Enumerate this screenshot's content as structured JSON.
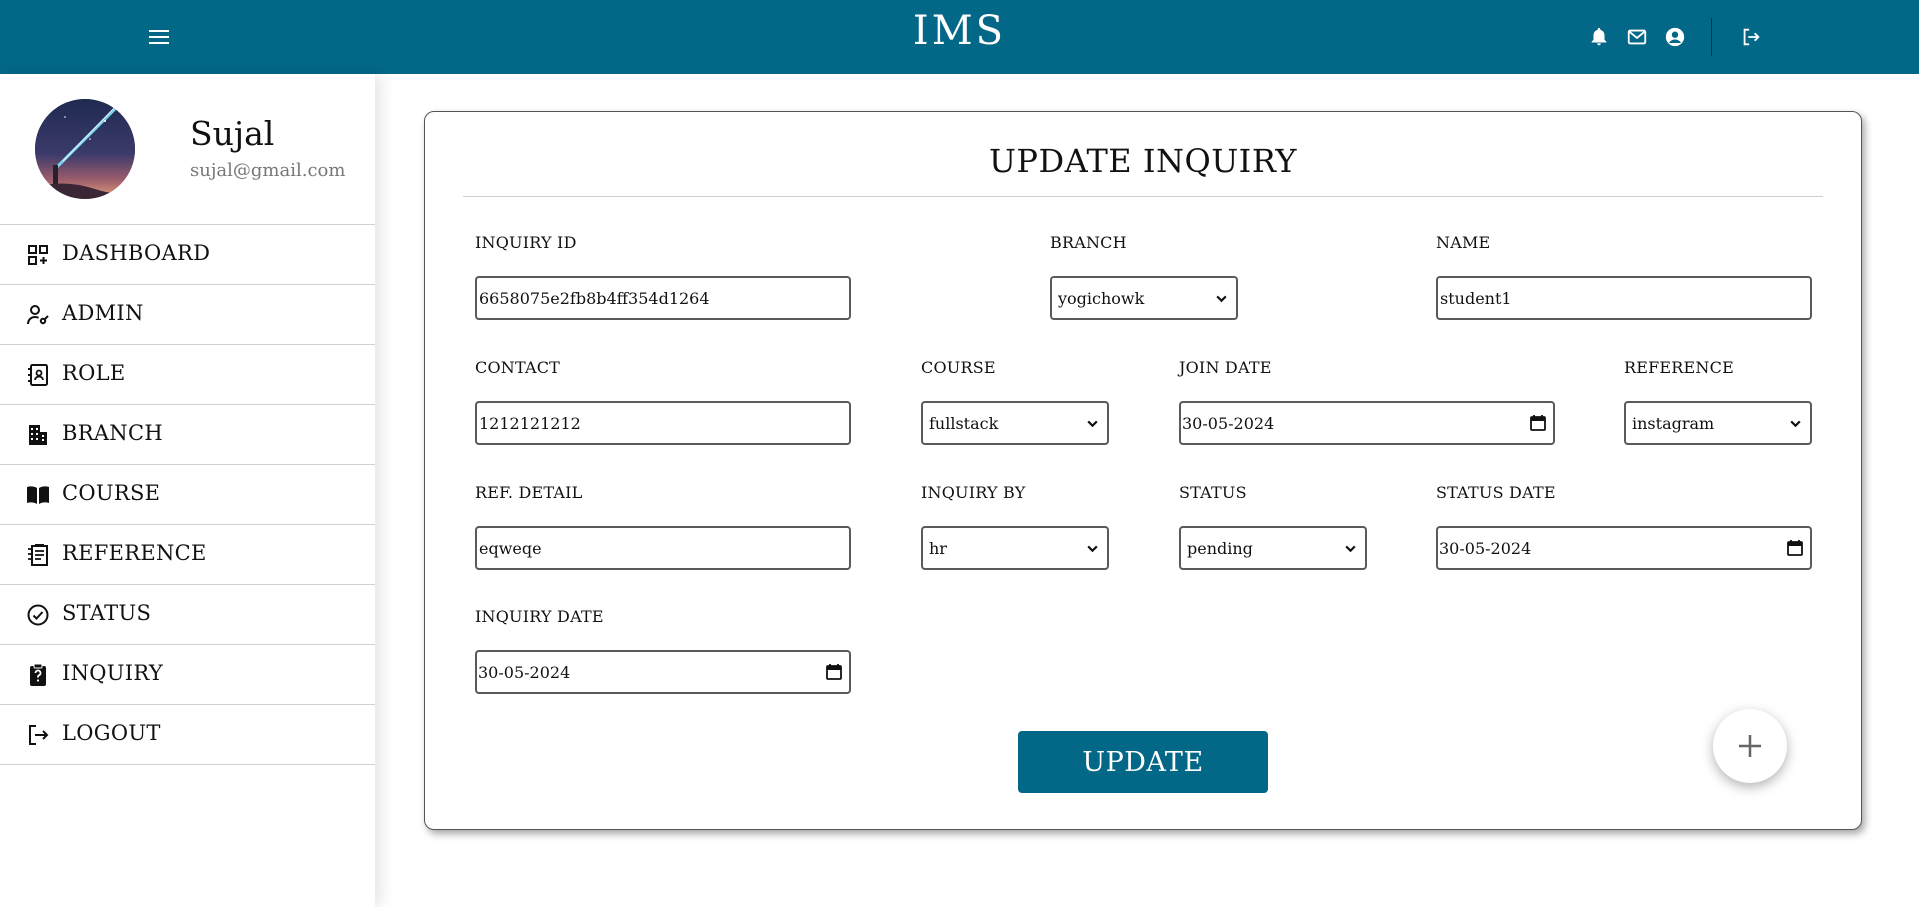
{
  "app": {
    "title": "IMS"
  },
  "topbar": {
    "icons": [
      "menu-icon",
      "bell-icon",
      "mail-icon",
      "account-icon",
      "logout-icon"
    ]
  },
  "profile": {
    "name": "Sujal",
    "email": "sujal@gmail.com"
  },
  "sidebar": {
    "items": [
      {
        "label": "DASHBOARD",
        "icon": "dashboard-icon"
      },
      {
        "label": "ADMIN",
        "icon": "admin-icon"
      },
      {
        "label": "ROLE",
        "icon": "role-icon"
      },
      {
        "label": "BRANCH",
        "icon": "building-icon"
      },
      {
        "label": "COURSE",
        "icon": "book-icon"
      },
      {
        "label": "REFERENCE",
        "icon": "reference-icon"
      },
      {
        "label": "STATUS",
        "icon": "check-circle-icon"
      },
      {
        "label": "INQUIRY",
        "icon": "clipboard-question-icon"
      },
      {
        "label": "LOGOUT",
        "icon": "logout-icon"
      }
    ]
  },
  "form": {
    "title": "UPDATE INQUIRY",
    "fields": {
      "inquiry_id": {
        "label": "INQUIRY ID",
        "value": "6658075e2fb8b4ff354d1264"
      },
      "branch": {
        "label": "BRANCH",
        "value": "yogichowk"
      },
      "name": {
        "label": "NAME",
        "value": "student1"
      },
      "contact": {
        "label": "CONTACT",
        "value": "1212121212"
      },
      "course": {
        "label": "COURSE",
        "value": "fullstack"
      },
      "join_date": {
        "label": "JOIN DATE",
        "value": "30-05-2024"
      },
      "reference": {
        "label": "REFERENCE",
        "value": "instagram"
      },
      "ref_detail": {
        "label": "REF. DETAIL",
        "value": "eqweqe"
      },
      "inquiry_by": {
        "label": "INQUIRY BY",
        "value": "hr"
      },
      "status": {
        "label": "STATUS",
        "value": "pending"
      },
      "status_date": {
        "label": "STATUS DATE",
        "value": "30-05-2024"
      },
      "inquiry_date": {
        "label": "INQUIRY DATE",
        "value": "30-05-2024"
      }
    },
    "submit_label": "UPDATE"
  },
  "colors": {
    "primary": "#036788",
    "text": "#111111",
    "muted": "#777777",
    "border": "#5a5a5a"
  }
}
